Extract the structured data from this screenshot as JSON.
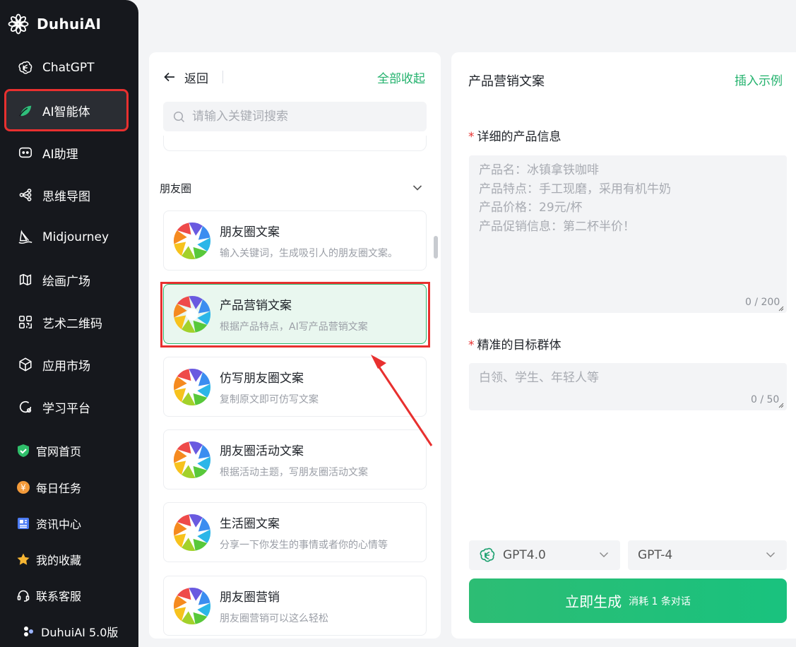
{
  "app": {
    "name": "DuhuiAI",
    "version": "DuhuiAI 5.0版"
  },
  "sidebar": {
    "items": [
      {
        "label": "ChatGPT",
        "icon": "openai-icon"
      },
      {
        "label": "AI智能体",
        "icon": "leaf-icon"
      },
      {
        "label": "AI助理",
        "icon": "robot-icon"
      },
      {
        "label": "思维导图",
        "icon": "mindmap-icon"
      },
      {
        "label": "Midjourney",
        "icon": "sailboat-icon"
      },
      {
        "label": "绘画广场",
        "icon": "map-icon"
      },
      {
        "label": "艺术二维码",
        "icon": "qrcode-icon"
      },
      {
        "label": "应用市场",
        "icon": "cube-icon"
      },
      {
        "label": "学习平台",
        "icon": "learn-icon"
      }
    ],
    "links": [
      {
        "label": "官网首页",
        "icon": "shield-check-icon"
      },
      {
        "label": "每日任务",
        "icon": "coin-icon"
      },
      {
        "label": "资讯中心",
        "icon": "news-icon"
      },
      {
        "label": "我的收藏",
        "icon": "star-icon"
      },
      {
        "label": "联系客服",
        "icon": "headset-icon"
      }
    ]
  },
  "middle": {
    "back_label": "返回",
    "collapse_all": "全部收起",
    "search_placeholder": "请输入关键词搜索",
    "category": "朋友圈",
    "cards": [
      {
        "title": "朋友圈文案",
        "desc": "输入关键词，生成吸引人的朋友圈文案。"
      },
      {
        "title": "产品营销文案",
        "desc": "根据产品特点，AI写产品营销文案"
      },
      {
        "title": "仿写朋友圈文案",
        "desc": "复制原文即可仿写文案"
      },
      {
        "title": "朋友圈活动文案",
        "desc": "根据活动主题，写朋友圈活动文案"
      },
      {
        "title": "生活圈文案",
        "desc": "分享一下你发生的事情或者你的心情等"
      },
      {
        "title": "朋友圈营销",
        "desc": "朋友圈营销可以这么轻松"
      }
    ]
  },
  "right": {
    "title": "产品营销文案",
    "insert_example": "插入示例",
    "field1": {
      "required_mark": "*",
      "label": "详细的产品信息",
      "placeholder": "产品名：冰镇拿铁咖啡\n产品特点：手工现磨，采用有机牛奶\n产品价格：29元/杯\n产品促销信息：第二杯半价！",
      "counter": "0 / 200"
    },
    "field2": {
      "required_mark": "*",
      "label": "精准的目标群体",
      "placeholder": "白领、学生、年轻人等",
      "counter": "0 / 50"
    },
    "model_select": "GPT4.0",
    "submodel_select": "GPT-4",
    "generate_label": "立即生成",
    "generate_cost": "消耗 1 条对话"
  },
  "colors": {
    "accent_green": "#23b26d",
    "highlight_red": "#e8302f",
    "sidebar_bg": "#16181d"
  }
}
